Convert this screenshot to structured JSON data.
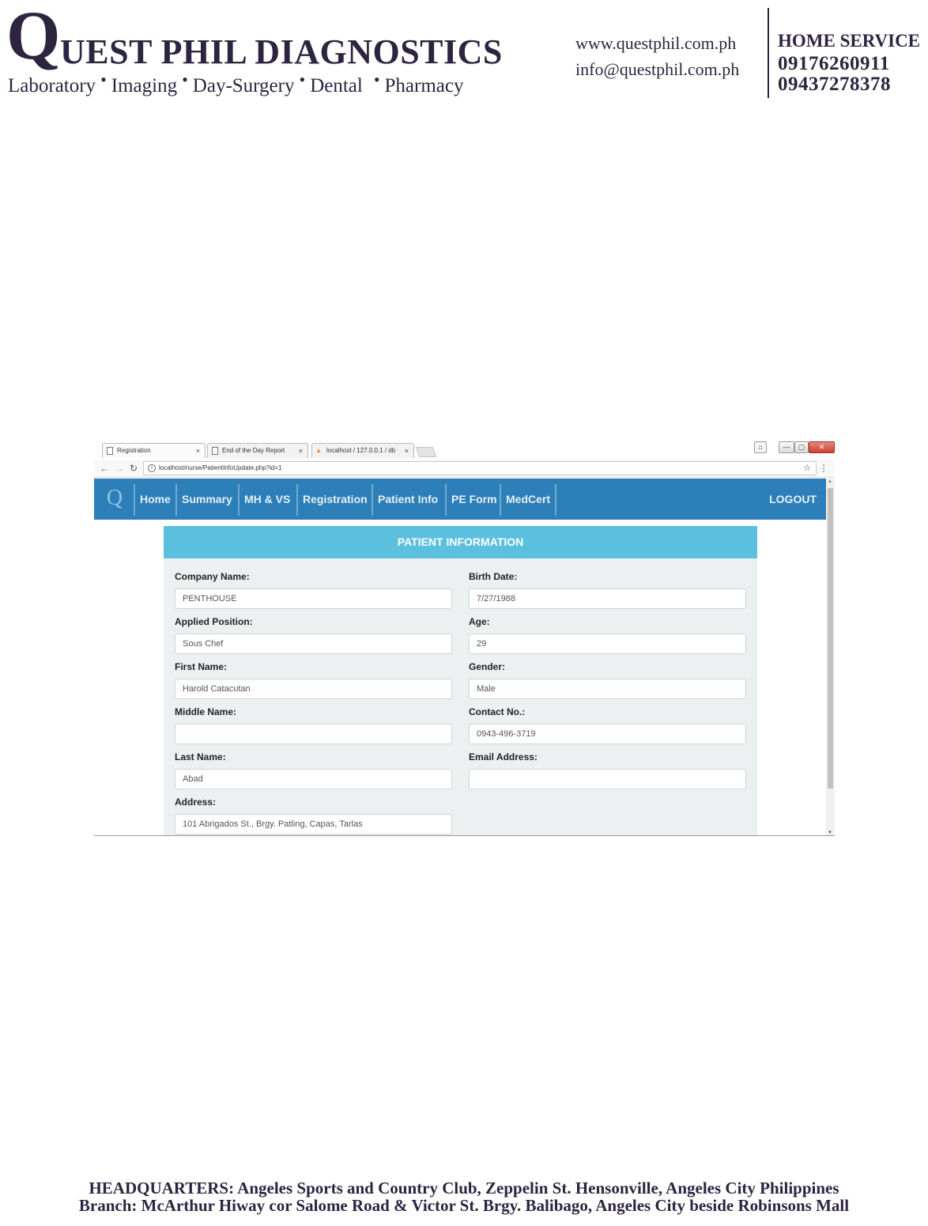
{
  "letterhead": {
    "brand_initial": "Q",
    "brand_rest": "UEST PHIL DIAGNOSTICS",
    "services": [
      "Laboratory",
      "Imaging",
      "Day-Surgery",
      "Dental",
      "Pharmacy"
    ],
    "website": "www.questphil.com.ph",
    "email": "info@questphil.com.ph",
    "home_service_title": "HOME SERVICE",
    "phones": [
      "09176260911",
      "09437278378"
    ],
    "brand_color": "#2d2440"
  },
  "browser": {
    "tabs": [
      {
        "title": "Registration",
        "active": true
      },
      {
        "title": "End of the Day Report",
        "active": false
      },
      {
        "title": "localhost / 127.0.0.1 / db",
        "active": false
      }
    ],
    "tab_close_glyph": "×",
    "url": "localhost/nurse/PatientInfoUpdate.php?id=1",
    "window_buttons": [
      "—",
      "▢",
      "✕"
    ]
  },
  "app": {
    "logo_glyph": "Q",
    "nav": [
      "Home",
      "Summary",
      "MH & VS",
      "Registration",
      "Patient Info",
      "PE Form",
      "MedCert"
    ],
    "logout_label": "LOGOUT",
    "navbar_color": "#2c7fb8",
    "header_color": "#5bc0de",
    "card_title": "PATIENT INFORMATION",
    "fields_left": [
      {
        "label": "Company Name:",
        "value": "PENTHOUSE"
      },
      {
        "label": "Applied Position:",
        "value": "Sous Chef"
      },
      {
        "label": "First Name:",
        "value": "Harold Catacutan"
      },
      {
        "label": "Middle Name:",
        "value": ""
      },
      {
        "label": "Last Name:",
        "value": "Abad"
      },
      {
        "label": "Address:",
        "value": "101 Abrigados St., Brgy. Patling, Capas, Tarlas"
      }
    ],
    "fields_right": [
      {
        "label": "Birth Date:",
        "value": "7/27/1988"
      },
      {
        "label": "Age:",
        "value": "29"
      },
      {
        "label": "Gender:",
        "value": "Male"
      },
      {
        "label": "Contact No.:",
        "value": "0943-496-3719"
      },
      {
        "label": "Email Address:",
        "value": ""
      }
    ]
  },
  "footer": {
    "headquarters": "HEADQUARTERS: Angeles Sports and Country Club, Zeppelin St. Hensonville, Angeles City Philippines",
    "branch": "Branch: McArthur Hiway cor Salome Road & Victor St. Brgy. Balibago, Angeles City beside Robinsons Mall"
  }
}
